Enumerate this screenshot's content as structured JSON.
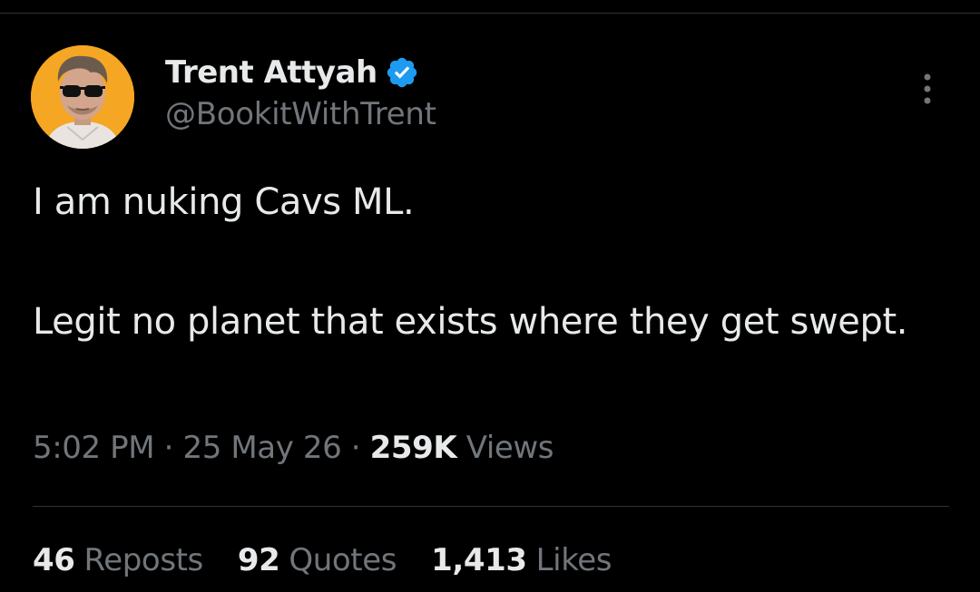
{
  "user": {
    "display_name": "Trent Attyah",
    "handle": "@BookitWithTrent",
    "verified": true,
    "avatar_icon": "profile-photo"
  },
  "tweet": {
    "lines": [
      "I am nuking Cavs ML.",
      "Legit no planet that exists where they get swept."
    ]
  },
  "meta": {
    "time": "5:02 PM",
    "separator": "·",
    "date": "25 May 26",
    "views_count": "259K",
    "views_label": "Views"
  },
  "stats": [
    {
      "count": "46",
      "label": "Reposts"
    },
    {
      "count": "92",
      "label": "Quotes"
    },
    {
      "count": "1,413",
      "label": "Likes"
    }
  ],
  "colors": {
    "background": "#000000",
    "primary_text": "#e7e9ea",
    "secondary_text": "#71767b",
    "verified_badge": "#1d9bf0",
    "divider": "#2f3336",
    "avatar_bg": "#f5a623"
  },
  "icons": {
    "verified": "verified-badge-icon",
    "more": "more-options-icon"
  }
}
